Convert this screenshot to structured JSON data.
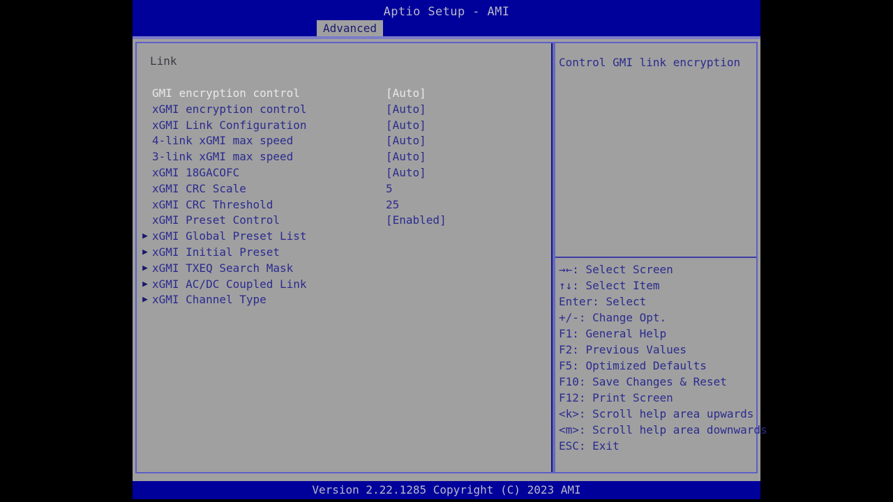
{
  "window": {
    "title": "Aptio Setup - AMI",
    "active_tab": "Advanced",
    "tabs": [
      "Advanced"
    ]
  },
  "colors": {
    "title_bar_bg": "#00009b",
    "panel_bg": "#a0a0a0",
    "item_text": "#2b2b8f",
    "selected_text": "#e8e8ec",
    "heading_text": "#3a3a44",
    "border": "#5f5fc8",
    "footer_bg": "#00009b",
    "footer_text": "#b9b9c8"
  },
  "main": {
    "section_heading": "Link",
    "items": [
      {
        "label": "GMI encryption control",
        "value": "[Auto]",
        "arrow": "",
        "selected": true
      },
      {
        "label": "xGMI encryption control",
        "value": "[Auto]",
        "arrow": "",
        "selected": false
      },
      {
        "label": "xGMI Link Configuration",
        "value": "[Auto]",
        "arrow": "",
        "selected": false
      },
      {
        "label": "4-link xGMI max speed",
        "value": "[Auto]",
        "arrow": "",
        "selected": false
      },
      {
        "label": "3-link xGMI max speed",
        "value": "[Auto]",
        "arrow": "",
        "selected": false
      },
      {
        "label": "xGMI 18GACOFC",
        "value": "[Auto]",
        "arrow": "",
        "selected": false
      },
      {
        "label": "xGMI CRC Scale",
        "value": "5",
        "arrow": "",
        "selected": false
      },
      {
        "label": "xGMI CRC Threshold",
        "value": "25",
        "arrow": "",
        "selected": false
      },
      {
        "label": "xGMI Preset Control",
        "value": "[Enabled]",
        "arrow": "",
        "selected": false
      },
      {
        "label": "xGMI Global Preset List",
        "value": "",
        "arrow": "▶",
        "selected": false
      },
      {
        "label": "xGMI Initial Preset",
        "value": "",
        "arrow": "▶",
        "selected": false
      },
      {
        "label": "xGMI TXEQ Search Mask",
        "value": "",
        "arrow": "▶",
        "selected": false
      },
      {
        "label": "xGMI AC/DC Coupled Link",
        "value": "",
        "arrow": "▶",
        "selected": false
      },
      {
        "label": "xGMI Channel Type",
        "value": "",
        "arrow": "▶",
        "selected": false
      }
    ]
  },
  "help": {
    "text": "Control GMI link encryption"
  },
  "legend": {
    "entries": [
      {
        "keys": "→←",
        "desc": ": Select Screen"
      },
      {
        "keys": "↑↓",
        "desc": ": Select Item"
      },
      {
        "keys": "Enter",
        "desc": ": Select"
      },
      {
        "keys": "+/-",
        "desc": ": Change Opt."
      },
      {
        "keys": "F1",
        "desc": ": General Help"
      },
      {
        "keys": "F2",
        "desc": ": Previous Values"
      },
      {
        "keys": "F5",
        "desc": ": Optimized Defaults"
      },
      {
        "keys": "F10",
        "desc": ": Save Changes & Reset"
      },
      {
        "keys": "F12",
        "desc": ": Print Screen"
      },
      {
        "keys": "<k>",
        "desc": ": Scroll help area upwards"
      },
      {
        "keys": "<m>",
        "desc": ": Scroll help area downwards"
      },
      {
        "keys": "ESC",
        "desc": ": Exit"
      }
    ]
  },
  "footer": {
    "text": "Version 2.22.1285 Copyright (C) 2023 AMI"
  }
}
